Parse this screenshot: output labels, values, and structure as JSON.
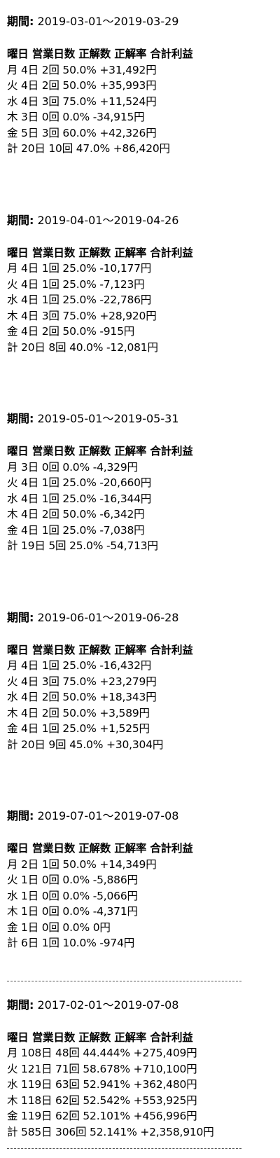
{
  "blocks": [
    {
      "period_prefix": "期間:",
      "period_range": " 2019-03-01～2019-03-29",
      "header": "曜日 営業日数 正解数 正解率 合計利益",
      "rows": [
        "月 4日 2回 50.0% +31,492円",
        "火 4日 2回 50.0% +35,993円",
        "水 4日 3回 75.0% +11,524円",
        "木 3日 0回 0.0% -34,915円",
        "金 5日 3回 60.0% +42,326円",
        "計 20日 10回 47.0% +86,420円"
      ]
    },
    {
      "period_prefix": "期間:",
      "period_range": " 2019-04-01～2019-04-26",
      "header": "曜日 営業日数 正解数 正解率 合計利益",
      "rows": [
        "月 4日 1回 25.0% -10,177円",
        "火 4日 1回 25.0% -7,123円",
        "水 4日 1回 25.0% -22,786円",
        "木 4日 3回 75.0% +28,920円",
        "金 4日 2回 50.0% -915円",
        "計 20日 8回 40.0% -12,081円"
      ]
    },
    {
      "period_prefix": "期間:",
      "period_range": " 2019-05-01～2019-05-31",
      "header": "曜日 営業日数 正解数 正解率 合計利益",
      "rows": [
        "月 3日 0回 0.0% -4,329円",
        "火 4日 1回 25.0% -20,660円",
        "水 4日 1回 25.0% -16,344円",
        "木 4日 2回 50.0% -6,342円",
        "金 4日 1回 25.0% -7,038円",
        "計 19日 5回 25.0% -54,713円"
      ]
    },
    {
      "period_prefix": "期間:",
      "period_range": " 2019-06-01～2019-06-28",
      "header": "曜日 営業日数 正解数 正解率 合計利益",
      "rows": [
        "月 4日 1回 25.0% -16,432円",
        "火 4日 3回 75.0% +23,279円",
        "水 4日 2回 50.0% +18,343円",
        "木 4日 2回 50.0% +3,589円",
        "金 4日 1回 25.0% +1,525円",
        "計 20日 9回 45.0% +30,304円"
      ]
    },
    {
      "period_prefix": "期間:",
      "period_range": " 2019-07-01～2019-07-08",
      "header": "曜日 営業日数 正解数 正解率 合計利益",
      "rows": [
        "月 2日 1回 50.0% +14,349円",
        "火 1日 0回 0.0% -5,886円",
        "水 1日 0回 0.0% -5,066円",
        "木 1日 0回 0.0% -4,371円",
        "金 1日 0回 0.0% 0円",
        "計 6日 1回 10.0% -974円"
      ]
    }
  ],
  "overall": {
    "period_prefix": "期間:",
    "period_range": " 2017-02-01～2019-07-08",
    "header": "曜日 営業日数 正解数 正解率 合計利益",
    "rows": [
      "月 108日 48回 44.444% +275,409円",
      "火 121日 71回 58.678% +710,100円",
      "水 119日 63回 52.941% +362,480円",
      "木 118日 62回 52.542% +553,925円",
      "金 119日 62回 52.101% +456,996円",
      "計 585日 306回 52.141% +2,358,910円"
    ]
  }
}
